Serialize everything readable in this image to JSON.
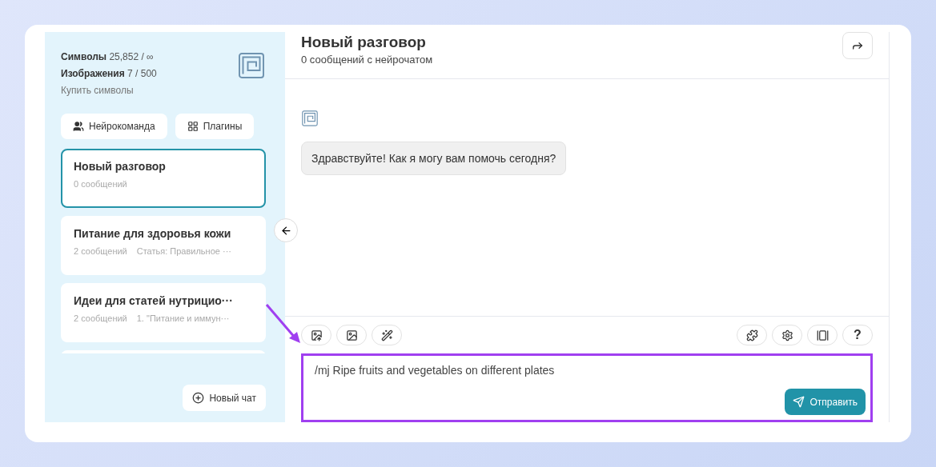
{
  "sidebar": {
    "stats": [
      {
        "label": "Символы",
        "value": "25,852 / ∞"
      },
      {
        "label": "Изображения",
        "value": "7 / 500"
      }
    ],
    "buy_link": "Купить символы",
    "buttons": [
      {
        "kind": "team",
        "label": "Нейрокоманда"
      },
      {
        "kind": "plugins",
        "label": "Плагины"
      }
    ],
    "chats": [
      {
        "title": "Новый разговор",
        "count": "0 сообщений",
        "selected": true
      },
      {
        "title": "Питание для здоровья кожи",
        "count": "2 сообщений",
        "preview": "Статья: Правильное ···",
        "selected": false
      },
      {
        "title": "Идеи для статей нутрицио···",
        "count": "2 сообщений",
        "preview": "1. \"Питание и иммун···",
        "selected": false
      },
      {
        "selected": false
      }
    ],
    "new_chat": "Новый чат"
  },
  "header": {
    "title": "Новый разговор",
    "subtitle": "0 сообщений с нейрочатом"
  },
  "messages": [
    {
      "text": "Здравствуйте! Как я могу вам помочь сегодня?"
    }
  ],
  "toolbar": {
    "left": [
      {
        "kind": "upload"
      },
      {
        "kind": "image"
      },
      {
        "kind": "magic"
      }
    ],
    "right": [
      {
        "kind": "puzzle"
      },
      {
        "kind": "gear"
      },
      {
        "kind": "gallery"
      },
      {
        "kind": "help",
        "label": "?"
      }
    ]
  },
  "input": {
    "value": "/mj Ripe fruits and vegetables on different plates",
    "send": "Отправить"
  }
}
